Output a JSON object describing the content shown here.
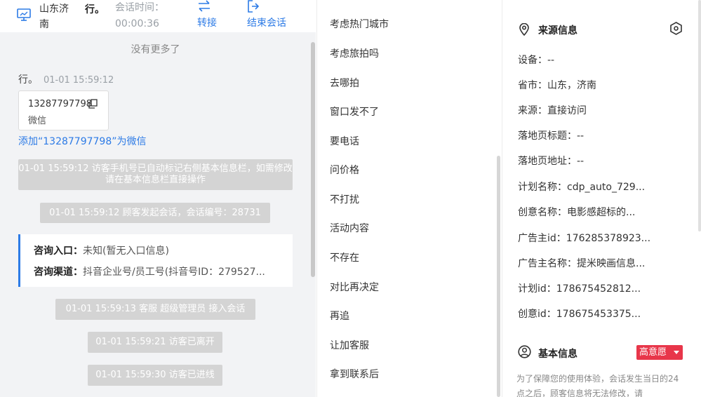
{
  "header": {
    "city": "山东济南",
    "customer_name": "行。",
    "session_time_label": "会话时间：",
    "session_time_value": "00:00:36",
    "transfer_label": "转接",
    "end_label": "结束会话"
  },
  "chat": {
    "no_more": "没有更多了",
    "message": {
      "sender": "行。",
      "time": "01-01 15:59:12",
      "card_phone": "13287797798",
      "card_type": "微信"
    },
    "add_wechat": "添加“13287797798”为微信",
    "system_messages": [
      "01-01 15:59:12 访客手机号已自动标记右侧基本信息栏，如需修改请在基本信息栏直接操作",
      "01-01 15:59:12 顾客发起会话，会话编号：28731",
      "01-01 15:59:13 客服 超级管理员 接入会话",
      "01-01 15:59:21 访客已离开",
      "01-01 15:59:30 访客已进线"
    ],
    "consult": {
      "entry_label": "咨询入口：",
      "entry_value": "未知(暂无入口信息)",
      "channel_label": "咨询渠道：",
      "channel_value": "抖音企业号/员工号(抖音号ID：279527..."
    }
  },
  "quick_replies": [
    "考虑热门城市",
    "考虑旅拍吗",
    "去哪拍",
    "窗口发不了",
    "要电话",
    "问价格",
    "不打扰",
    "活动内容",
    "不存在",
    "对比再决定",
    "再追",
    "让加客服",
    "拿到联系后"
  ],
  "source_info": {
    "title": "来源信息",
    "rows": [
      "设备：--",
      "省市：山东，济南",
      "来源：直接访问",
      "落地页标题：--",
      "落地页地址：--",
      "计划名称：cdp_auto_729...",
      "创意名称：电影感超标的...",
      "广告主id：176285378923...",
      "广告主名称：提米映画信息...",
      "计划id：178675452812...",
      "创意id：178675453375..."
    ]
  },
  "basic_info": {
    "title": "基本信息",
    "intent_badge": "高意愿",
    "notice": "为了保障您的使用体验，会话发生当日的24点之后，顾客信息将无法修改，请"
  },
  "colors": {
    "accent": "#2d7be6",
    "badge": "#e8364a",
    "system_bubble": "#d4d4d4"
  }
}
